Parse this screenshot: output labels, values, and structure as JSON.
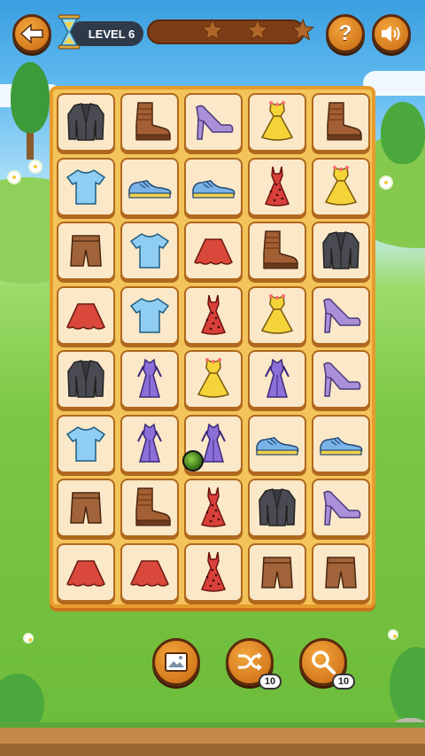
{
  "header": {
    "level_label": "LEVEL 6",
    "progress_fraction": 0.0,
    "stars_earned": 0,
    "stars_total": 3,
    "back_icon": "back-arrow-icon",
    "help_icon": "question-icon",
    "sound_icon": "speaker-icon"
  },
  "board": {
    "rows": 8,
    "cols": 5,
    "tiles": [
      [
        "jacket",
        "boot",
        "heel",
        "yellow-dress",
        "boot"
      ],
      [
        "tshirt",
        "sneaker",
        "sneaker",
        "red-dress",
        "yellow-dress"
      ],
      [
        "shorts",
        "tshirt",
        "skirt",
        "boot",
        "jacket"
      ],
      [
        "skirt",
        "tshirt",
        "red-dress",
        "yellow-dress",
        "heel"
      ],
      [
        "jacket",
        "purple-dress",
        "yellow-dress",
        "purple-dress",
        "heel"
      ],
      [
        "tshirt",
        "purple-dress",
        "purple-dress",
        "sneaker",
        "sneaker"
      ],
      [
        "shorts",
        "boot",
        "red-dress",
        "jacket",
        "heel"
      ],
      [
        "skirt",
        "skirt",
        "red-dress",
        "shorts",
        "shorts"
      ]
    ]
  },
  "tools": {
    "picture": {
      "icon": "picture-icon"
    },
    "shuffle": {
      "icon": "shuffle-icon",
      "count": "10"
    },
    "search": {
      "icon": "magnifier-icon",
      "count": "10"
    }
  },
  "colors": {
    "board_bg": "#f3c45a",
    "tile_bg": "#fbe8c8",
    "tile_border": "#b0681f",
    "button_orange": "#d57a1e"
  }
}
